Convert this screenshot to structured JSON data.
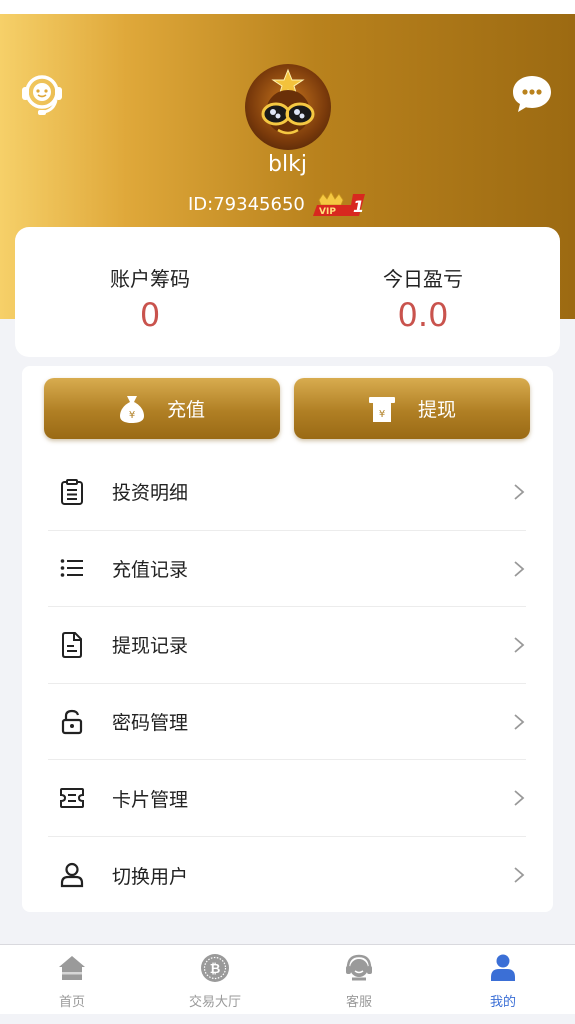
{
  "header": {
    "username": "blkj",
    "user_id": "ID:79345650",
    "vip_level": "1",
    "vip_text": "VIP"
  },
  "stats": {
    "chips_label": "账户筹码",
    "chips_value": "0",
    "pnl_label": "今日盈亏",
    "pnl_value": "0.0"
  },
  "actions": {
    "recharge_label": "充值",
    "withdraw_label": "提现"
  },
  "menu": {
    "items": [
      {
        "label": "投资明细",
        "icon": "document-list-icon"
      },
      {
        "label": "充值记录",
        "icon": "list-icon"
      },
      {
        "label": "提现记录",
        "icon": "file-icon"
      },
      {
        "label": "密码管理",
        "icon": "lock-icon"
      },
      {
        "label": "卡片管理",
        "icon": "ticket-icon"
      },
      {
        "label": "切换用户",
        "icon": "user-icon"
      }
    ]
  },
  "tabbar": {
    "tabs": [
      {
        "label": "首页",
        "icon": "home-icon",
        "active": false
      },
      {
        "label": "交易大厅",
        "icon": "bitcoin-icon",
        "active": false
      },
      {
        "label": "客服",
        "icon": "support-icon",
        "active": false
      },
      {
        "label": "我的",
        "icon": "profile-icon",
        "active": true
      }
    ]
  },
  "colors": {
    "accent_gold": "#b9821d",
    "value_red": "#c9534d",
    "tab_active": "#3b6fd6"
  }
}
